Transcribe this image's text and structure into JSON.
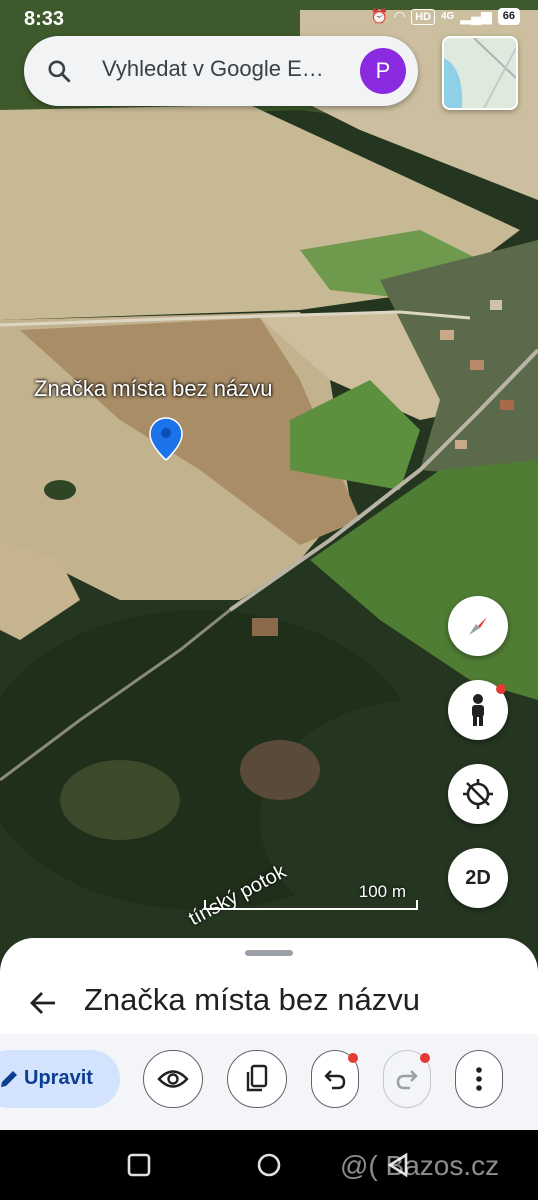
{
  "status": {
    "time": "8:33",
    "hd": "HD",
    "network": "4G",
    "battery": "66"
  },
  "search": {
    "placeholder": "Vyhledat v Google E…",
    "avatar_initial": "P"
  },
  "map": {
    "marker_label": "Značka místa bez názvu",
    "road_label": "tínský potok",
    "scale_label": "100 m",
    "view_mode_button": "2D"
  },
  "sheet": {
    "title": "Značka místa bez názvu",
    "edit_label": "Upravit"
  },
  "watermark": "@( Bazos.cz",
  "colors": {
    "accent_purple": "#8a2be2",
    "edit_bg": "#d3e3fd",
    "pin_blue": "#1a73e8",
    "notify_red": "#e53935"
  },
  "icons": [
    "search-icon",
    "compass-icon",
    "street-view-icon",
    "my-location-icon",
    "back-arrow-icon",
    "pencil-icon",
    "eye-icon",
    "layers-icon",
    "undo-icon",
    "redo-icon",
    "more-vert-icon"
  ]
}
